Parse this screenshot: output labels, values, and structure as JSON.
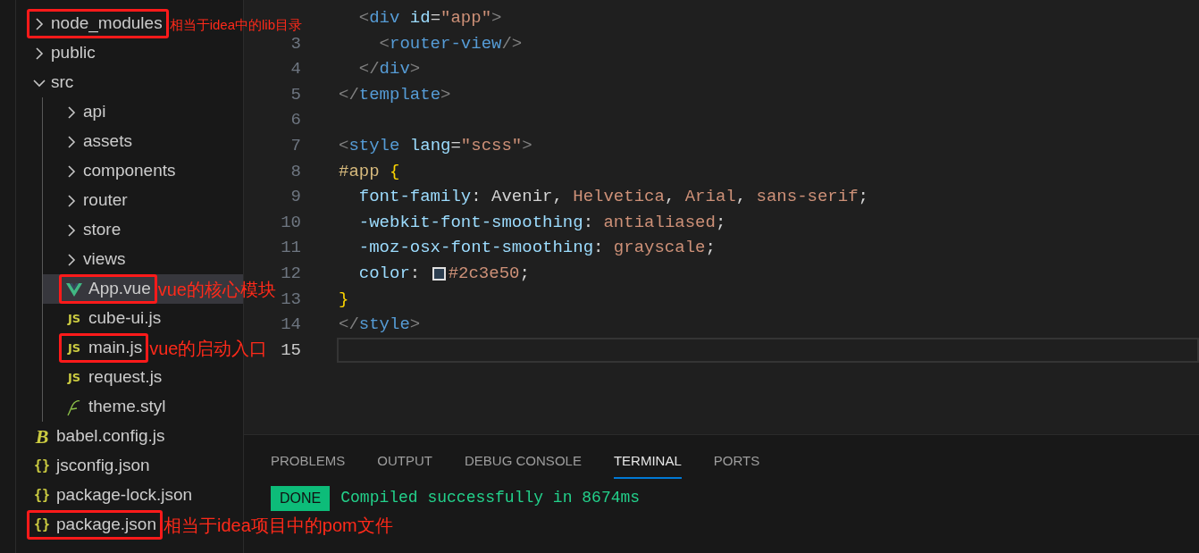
{
  "explorer": {
    "items": [
      {
        "name": "node_modules",
        "kind": "folder",
        "expanded": false,
        "selected": false,
        "boxed": true,
        "note": "相当于idea中的lib目录"
      },
      {
        "name": "public",
        "kind": "folder",
        "expanded": false,
        "selected": false,
        "boxed": false
      },
      {
        "name": "src",
        "kind": "folder",
        "expanded": true,
        "selected": false,
        "boxed": false,
        "children": [
          {
            "name": "api",
            "kind": "folder",
            "expanded": false,
            "selected": false,
            "boxed": false
          },
          {
            "name": "assets",
            "kind": "folder",
            "expanded": false,
            "selected": false,
            "boxed": false
          },
          {
            "name": "components",
            "kind": "folder",
            "expanded": false,
            "selected": false,
            "boxed": false
          },
          {
            "name": "router",
            "kind": "folder",
            "expanded": false,
            "selected": false,
            "boxed": false
          },
          {
            "name": "store",
            "kind": "folder",
            "expanded": false,
            "selected": false,
            "boxed": false
          },
          {
            "name": "views",
            "kind": "folder",
            "expanded": false,
            "selected": false,
            "boxed": false
          },
          {
            "name": "App.vue",
            "kind": "vue",
            "selected": true,
            "boxed": true,
            "note": "vue的核心模块"
          },
          {
            "name": "cube-ui.js",
            "kind": "js",
            "icon": "JS",
            "selected": false,
            "boxed": false
          },
          {
            "name": "main.js",
            "kind": "js",
            "icon": "JS",
            "selected": false,
            "boxed": true,
            "note": "vue的启动入口"
          },
          {
            "name": "request.js",
            "kind": "js",
            "icon": "JS",
            "selected": false,
            "boxed": false
          },
          {
            "name": "theme.styl",
            "kind": "styl",
            "selected": false,
            "boxed": false
          }
        ]
      },
      {
        "name": "babel.config.js",
        "kind": "babel",
        "icon": "B",
        "selected": false,
        "boxed": false
      },
      {
        "name": "jsconfig.json",
        "kind": "json",
        "icon": "{}",
        "selected": false,
        "boxed": false
      },
      {
        "name": "package-lock.json",
        "kind": "json",
        "icon": "{}",
        "selected": false,
        "boxed": false
      },
      {
        "name": "package.json",
        "kind": "json",
        "icon": "{}",
        "selected": false,
        "boxed": true,
        "note": "相当于idea项目中的pom文件"
      }
    ]
  },
  "editor": {
    "lines": [
      {
        "current": false,
        "tokens": [
          {
            "kind": "punct",
            "text": "  <"
          },
          {
            "kind": "tag",
            "text": "div"
          },
          {
            "kind": "attr",
            "text": " id"
          },
          {
            "kind": "plain",
            "text": "="
          },
          {
            "kind": "string",
            "text": "\"app\""
          },
          {
            "kind": "punct",
            "text": ">"
          }
        ]
      },
      {
        "number": "3",
        "current": false,
        "tokens": [
          {
            "kind": "punct",
            "text": "    <"
          },
          {
            "kind": "tag",
            "text": "router-view"
          },
          {
            "kind": "punct",
            "text": "/>"
          }
        ]
      },
      {
        "number": "4",
        "current": false,
        "tokens": [
          {
            "kind": "punct",
            "text": "  </"
          },
          {
            "kind": "tag",
            "text": "div"
          },
          {
            "kind": "punct",
            "text": ">"
          }
        ]
      },
      {
        "number": "5",
        "current": false,
        "tokens": [
          {
            "kind": "punct",
            "text": "</"
          },
          {
            "kind": "tag",
            "text": "template"
          },
          {
            "kind": "punct",
            "text": ">"
          }
        ]
      },
      {
        "number": "6",
        "current": false
      },
      {
        "number": "7",
        "current": false,
        "tokens": [
          {
            "kind": "punct",
            "text": "<"
          },
          {
            "kind": "tag",
            "text": "style"
          },
          {
            "kind": "attr",
            "text": " lang"
          },
          {
            "kind": "plain",
            "text": "="
          },
          {
            "kind": "string",
            "text": "\"scss\""
          },
          {
            "kind": "punct",
            "text": ">"
          }
        ]
      },
      {
        "number": "8",
        "current": false,
        "tokens": [
          {
            "kind": "selector",
            "text": "#app"
          },
          {
            "kind": "brace",
            "text": " {"
          }
        ]
      },
      {
        "number": "9",
        "current": false,
        "tokens": [
          {
            "kind": "attr",
            "text": "  font-family"
          },
          {
            "kind": "plain",
            "text": ": Avenir, "
          },
          {
            "kind": "string",
            "text": "Helvetica"
          },
          {
            "kind": "plain",
            "text": ", "
          },
          {
            "kind": "string",
            "text": "Arial"
          },
          {
            "kind": "plain",
            "text": ", "
          },
          {
            "kind": "string",
            "text": "sans-serif"
          },
          {
            "kind": "plain",
            "text": ";"
          }
        ]
      },
      {
        "number": "10",
        "current": false,
        "tokens": [
          {
            "kind": "attr",
            "text": "  -webkit-font-smoothing"
          },
          {
            "kind": "plain",
            "text": ": "
          },
          {
            "kind": "string",
            "text": "antialiased"
          },
          {
            "kind": "plain",
            "text": ";"
          }
        ]
      },
      {
        "number": "11",
        "current": false,
        "tokens": [
          {
            "kind": "attr",
            "text": "  -moz-osx-font-smoothing"
          },
          {
            "kind": "plain",
            "text": ": "
          },
          {
            "kind": "string",
            "text": "grayscale"
          },
          {
            "kind": "plain",
            "text": ";"
          }
        ]
      },
      {
        "number": "12",
        "current": false,
        "tokens": [
          {
            "kind": "attr",
            "text": "  color"
          },
          {
            "kind": "plain",
            "text": ": "
          },
          {
            "kind": "swatch",
            "color": "#2c3e50"
          },
          {
            "kind": "string",
            "text": "#2c3e50"
          },
          {
            "kind": "plain",
            "text": ";"
          }
        ]
      },
      {
        "number": "13",
        "current": false,
        "tokens": [
          {
            "kind": "brace",
            "text": "}"
          }
        ]
      },
      {
        "number": "14",
        "current": false,
        "tokens": [
          {
            "kind": "punct",
            "text": "</"
          },
          {
            "kind": "tag",
            "text": "style"
          },
          {
            "kind": "punct",
            "text": ">"
          }
        ]
      },
      {
        "number": "15",
        "current": true
      }
    ]
  },
  "panel": {
    "tabs": [
      {
        "label": "PROBLEMS",
        "selected": false
      },
      {
        "label": "OUTPUT",
        "selected": false
      },
      {
        "label": "DEBUG CONSOLE",
        "selected": false
      },
      {
        "label": "TERMINAL",
        "selected": true
      },
      {
        "label": "PORTS",
        "selected": false
      }
    ],
    "terminal": {
      "badge": "DONE",
      "message": "Compiled successfully in 8674ms"
    }
  }
}
